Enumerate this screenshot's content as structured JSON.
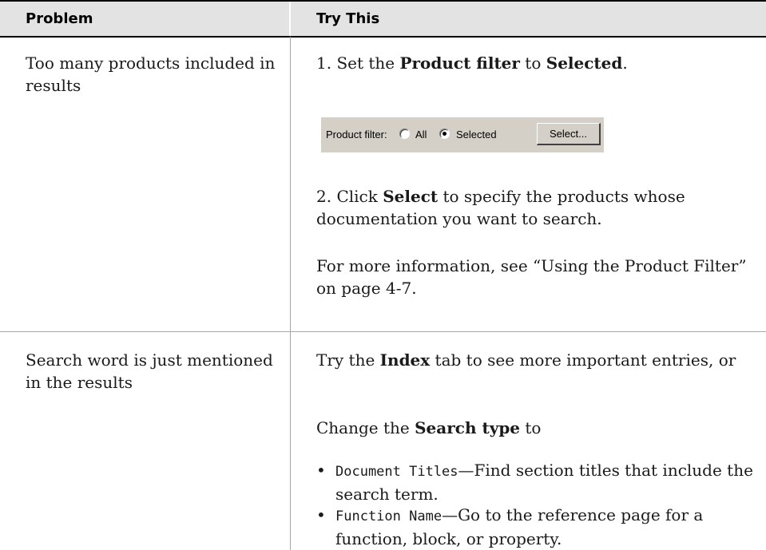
{
  "table": {
    "headers": {
      "problem": "Problem",
      "try_this": "Try This"
    },
    "rows": [
      {
        "problem": "Too many products included in results",
        "steps": {
          "step1": {
            "prefix": "1. Set the ",
            "b1": "Product filter",
            "mid": " to ",
            "b2": "Selected",
            "suffix": "."
          },
          "widget": {
            "label": "Product filter:",
            "option_all": "All",
            "option_selected": "Selected",
            "selected_option": "Selected",
            "button": "Select..."
          },
          "step2": {
            "prefix": "2. Click ",
            "b1": "Select",
            "suffix": " to specify the products whose documentation you want to search."
          },
          "more_info": "For more information, see “Using the Product Filter” on page 4-7."
        }
      },
      {
        "problem": "Search word is just mentioned in the results",
        "steps": {
          "index": {
            "prefix": "Try the ",
            "b1": "Index",
            "suffix": " tab to see more important entries, or"
          },
          "change": {
            "prefix": "Change the ",
            "b1": "Search type",
            "suffix": " to"
          },
          "bullets": [
            {
              "code": "Document Titles",
              "text": "—Find section titles that include the search term."
            },
            {
              "code": "Function Name",
              "text": "—Go to the reference page for a function, block, or property."
            }
          ]
        }
      }
    ]
  }
}
